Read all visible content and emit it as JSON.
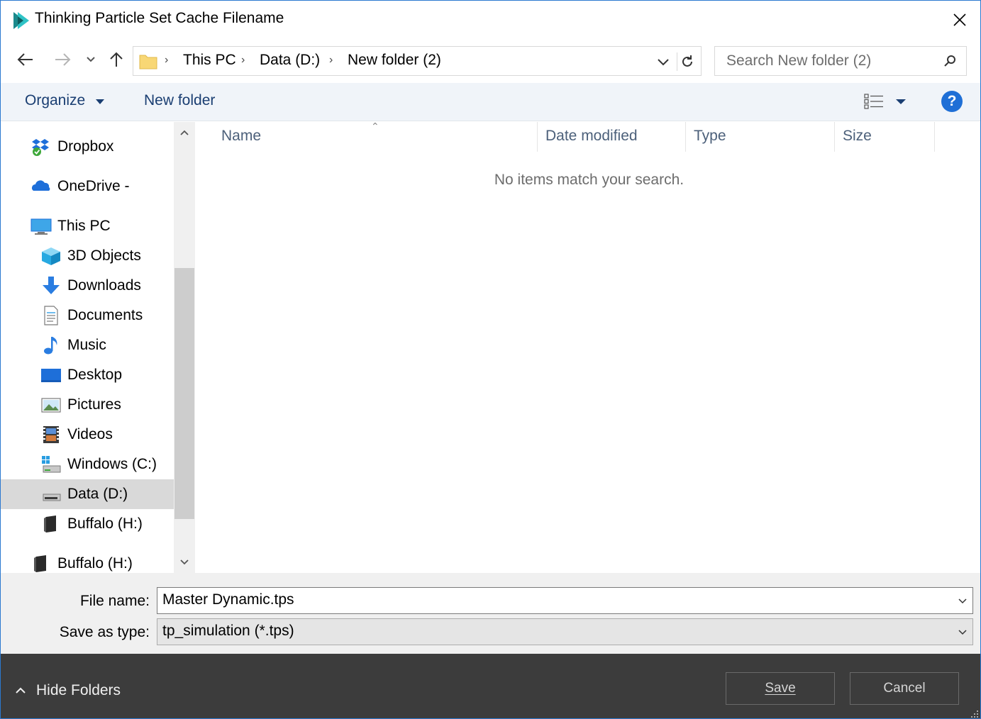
{
  "window": {
    "title": "Thinking Particle Set Cache Filename"
  },
  "navigation": {
    "breadcrumbs": [
      "This PC",
      "Data (D:)",
      "New folder (2)"
    ],
    "search_placeholder": "Search New folder (2)"
  },
  "toolbar": {
    "organize_label": "Organize",
    "new_folder_label": "New folder",
    "help_label": "?"
  },
  "nav_pane": {
    "items": [
      {
        "label": "Dropbox",
        "icon": "dropbox-icon"
      },
      {
        "label": "OneDrive -",
        "icon": "onedrive-icon"
      },
      {
        "label": "This PC",
        "icon": "this-pc-icon"
      },
      {
        "label": "3D Objects",
        "icon": "3d-objects-icon"
      },
      {
        "label": "Downloads",
        "icon": "downloads-icon"
      },
      {
        "label": "Documents",
        "icon": "documents-icon"
      },
      {
        "label": "Music",
        "icon": "music-icon"
      },
      {
        "label": "Desktop",
        "icon": "desktop-icon"
      },
      {
        "label": "Pictures",
        "icon": "pictures-icon"
      },
      {
        "label": "Videos",
        "icon": "videos-icon"
      },
      {
        "label": "Windows (C:)",
        "icon": "windows-drive-icon"
      },
      {
        "label": "Data (D:)",
        "icon": "drive-icon",
        "selected": true
      },
      {
        "label": "Buffalo (H:)",
        "icon": "external-drive-icon"
      },
      {
        "label": "Buffalo (H:)",
        "icon": "external-drive-icon"
      }
    ]
  },
  "content": {
    "columns": [
      "Name",
      "Date modified",
      "Type",
      "Size"
    ],
    "empty_message": "No items match your search."
  },
  "form": {
    "file_name_label": "File name:",
    "file_name_value": "Master Dynamic.tps",
    "save_type_label": "Save as type:",
    "save_type_value": "tp_simulation (*.tps)"
  },
  "footer": {
    "hide_folders_label": "Hide Folders",
    "save_label": "Save",
    "cancel_label": "Cancel"
  },
  "colors": {
    "accent": "#1f6fd6",
    "toolbar_bg": "#f0f4f9",
    "footer_bg": "#3c3c3c"
  }
}
